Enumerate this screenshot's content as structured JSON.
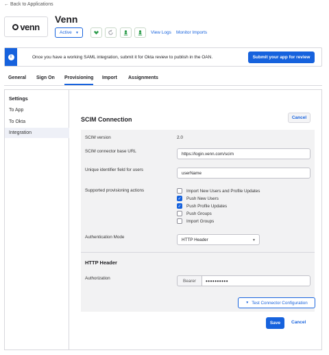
{
  "header": {
    "back_link": "← Back to Applications",
    "logo_text": "venn",
    "app_title": "Venn",
    "status": "Active",
    "view_logs": "View Logs",
    "monitor_imports": "Monitor Imports"
  },
  "banner": {
    "info_glyph": "i",
    "text": "Once you have a working SAML integration, submit it for Okta review to publish in the OAN.",
    "submit": "Submit your app for review"
  },
  "tabs": [
    "General",
    "Sign On",
    "Provisioning",
    "Import",
    "Assignments"
  ],
  "active_tab": "Provisioning",
  "sidebar": {
    "heading": "Settings",
    "items": [
      "To App",
      "To Okta",
      "Integration"
    ],
    "selected": "Integration"
  },
  "scim": {
    "title": "SCIM Connection",
    "cancel": "Cancel",
    "version_label": "SCIM version",
    "version_value": "2.0",
    "base_url_label": "SCIM connector base URL",
    "base_url_value": "https://login.venn.com/scim",
    "unique_id_label": "Unique identifier field for users",
    "unique_id_value": "userName",
    "actions_label": "Supported provisioning actions",
    "actions": [
      {
        "label": "Import New Users and Profile Updates",
        "checked": false
      },
      {
        "label": "Push New Users",
        "checked": true
      },
      {
        "label": "Push Profile Updates",
        "checked": true
      },
      {
        "label": "Push Groups",
        "checked": false
      },
      {
        "label": "Import Groups",
        "checked": false
      }
    ],
    "auth_mode_label": "Authentication Mode",
    "auth_mode_value": "HTTP Header",
    "http_header_title": "HTTP Header",
    "authorization_label": "Authorization",
    "bearer_prefix": "Bearer",
    "authorization_value": "••••••••••",
    "test_button": "Test Connector Configuration",
    "save": "Save",
    "cancel_bottom": "Cancel"
  },
  "colors": {
    "primary": "#1662dd",
    "success_icon": "#2c9c4a",
    "form_bg": "#f2f2f3"
  }
}
